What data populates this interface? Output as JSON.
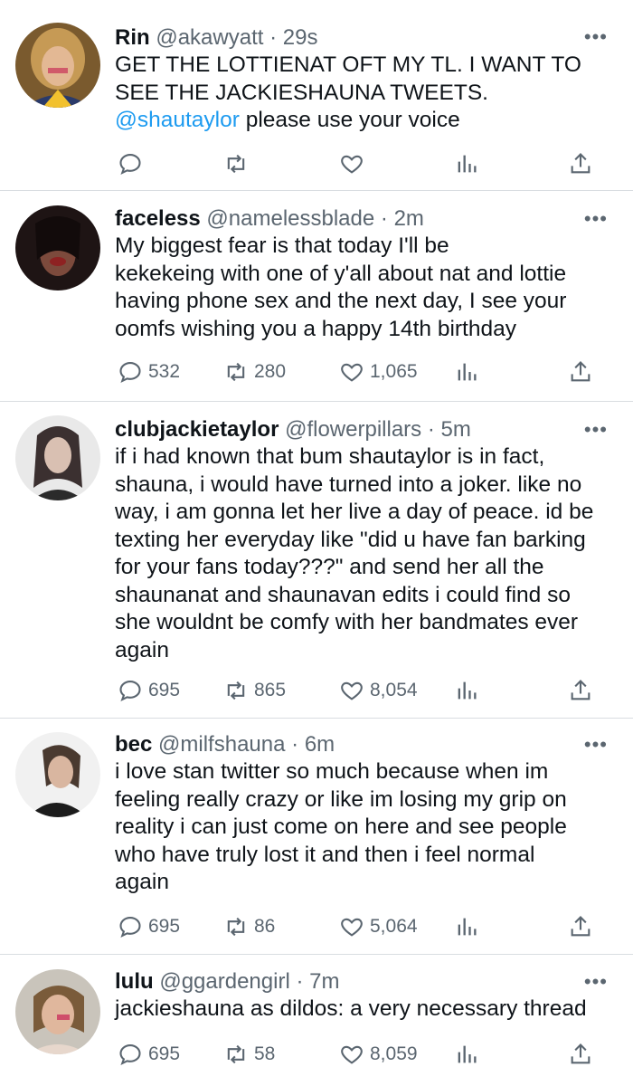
{
  "tweets": [
    {
      "name": "Rin",
      "handle": "@akawyatt",
      "time": "29s",
      "text_lines": [
        "GET THE LOTTIENAT OFT MY TL. I WANT TO",
        "SEE THE JACKIESHAUNA TWEETS."
      ],
      "mention": "@shautaylor",
      "mention_rest": " please use your voice",
      "replies": "",
      "retweets": "",
      "likes": ""
    },
    {
      "name": "faceless",
      "handle": "@namelessblade",
      "time": "2m",
      "text_lines": [
        "My biggest fear is that today I'll be",
        "kekekeing with one of y'all about nat and lottie",
        "having phone sex and the next day, I see your",
        "oomfs wishing you a happy 14th birthday"
      ],
      "replies": "532",
      "retweets": "280",
      "likes": "1,065"
    },
    {
      "name": "clubjackietaylor",
      "handle": "@flowerpillars",
      "time": "5m",
      "text_lines": [
        "if i had known that bum shautaylor is in fact,",
        "shauna, i would have turned into a joker. like no",
        "way, i am gonna let her live a day of peace. id be",
        "texting her everyday like \"did u have fan barking",
        "for your fans today???\" and send her all the",
        "shaunanat and shaunavan edits i could find so",
        "she wouldnt be comfy with her bandmates ever",
        "again"
      ],
      "replies": "695",
      "retweets": "865",
      "likes": "8,054"
    },
    {
      "name": "bec",
      "handle": "@milfshauna",
      "time": "6m",
      "text_lines": [
        "i love stan twitter so much because when im",
        "feeling really crazy or like im losing my grip on",
        "reality i can just come on here and see people",
        "who have truly lost it and then i feel normal",
        "again"
      ],
      "replies": "695",
      "retweets": "86",
      "likes": "5,064"
    },
    {
      "name": "lulu",
      "handle": "@ggardengirl",
      "time": "7m",
      "text_lines": [
        "jackieshauna as dildos: a very necessary thread"
      ],
      "replies": "695",
      "retweets": "58",
      "likes": "8,059"
    }
  ],
  "separator": "·",
  "more_glyph": "•••",
  "colors": {
    "link": "#1d9bf0",
    "secondary": "#5b6670",
    "text": "#0f1419",
    "divider": "#d9dde1"
  }
}
